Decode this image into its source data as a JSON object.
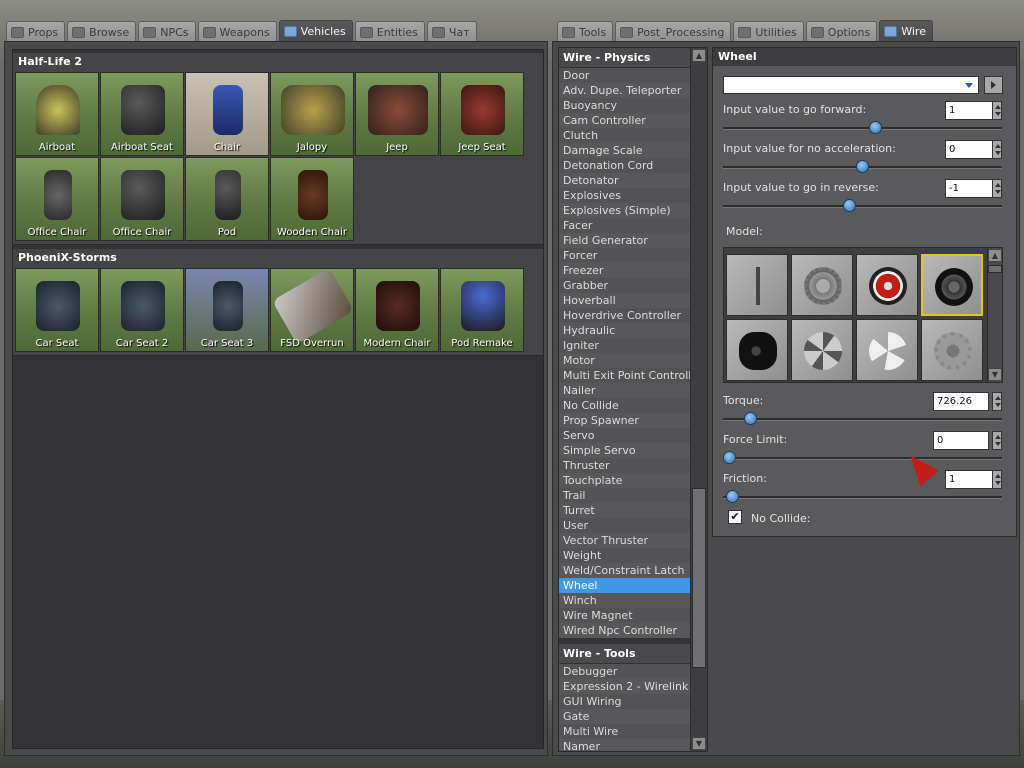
{
  "spawnmenu": {
    "tabs": [
      {
        "label": "Props",
        "icon": "grid-icon"
      },
      {
        "label": "Browse",
        "icon": "browse-icon"
      },
      {
        "label": "NPCs",
        "icon": "npc-icon"
      },
      {
        "label": "Weapons",
        "icon": "weapon-icon"
      },
      {
        "label": "Vehicles",
        "icon": "car-icon",
        "active": true
      },
      {
        "label": "Entities",
        "icon": "entity-icon"
      },
      {
        "label": "Чат",
        "icon": "chat-icon"
      }
    ],
    "categories": [
      {
        "title": "Half-Life 2",
        "items": [
          "Airboat",
          "Airboat Seat",
          "Chair",
          "Jalopy",
          "Jeep",
          "Jeep Seat",
          "Office Chair",
          "Office Chair",
          "Pod",
          "Wooden Chair"
        ]
      },
      {
        "title": "PhoeniX-Storms",
        "items": [
          "Car Seat",
          "Car Seat 2",
          "Car Seat 3",
          "FSD Overrun",
          "Modern Chair",
          "Pod Remake"
        ]
      }
    ]
  },
  "toolmenu": {
    "tabs": [
      {
        "label": "Tools",
        "icon": "wrench-icon"
      },
      {
        "label": "Post_Processing",
        "icon": "doc-icon"
      },
      {
        "label": "Utilities",
        "icon": "wrench-icon"
      },
      {
        "label": "Options",
        "icon": "options-icon"
      },
      {
        "label": "Wire",
        "icon": "wrench-icon",
        "active": true
      }
    ],
    "physics_header": "Wire - Physics",
    "physics_items": [
      "Door",
      "Adv. Dupe. Teleporter",
      "Buoyancy",
      "Cam Controller",
      "Clutch",
      "Damage Scale",
      "Detonation Cord",
      "Detonator",
      "Explosives",
      "Explosives (Simple)",
      "Facer",
      "Field Generator",
      "Forcer",
      "Freezer",
      "Grabber",
      "Hoverball",
      "Hoverdrive Controller",
      "Hydraulic",
      "Igniter",
      "Motor",
      "Multi Exit Point Controller",
      "Nailer",
      "No Collide",
      "Prop Spawner",
      "Servo",
      "Simple Servo",
      "Thruster",
      "Touchplate",
      "Trail",
      "Turret",
      "User",
      "Vector Thruster",
      "Weight",
      "Weld/Constraint Latch",
      "Wheel",
      "Winch",
      "Wire Magnet",
      "Wired Npc Controller"
    ],
    "selected_item": "Wheel",
    "tools_header": "Wire - Tools",
    "tools_items": [
      "Debugger",
      "Expression 2 - Wirelink",
      "GUI Wiring",
      "Gate",
      "Multi Wire",
      "Namer"
    ]
  },
  "wheel_panel": {
    "title": "Wheel",
    "preset_value": "",
    "forward_label": "Input value to go forward:",
    "forward_value": "1",
    "forward_fraction": 0.55,
    "noaccel_label": "Input value for no acceleration:",
    "noaccel_value": "0",
    "noaccel_fraction": 0.5,
    "reverse_label": "Input value to go in reverse:",
    "reverse_value": "-1",
    "reverse_fraction": 0.45,
    "model_label": "Model:",
    "models": [
      "axle-model-icon",
      "gear-model-icon",
      "red-rim-wheel-icon",
      "tire-wheel-icon",
      "thick-tire-icon",
      "fan-wheel-icon",
      "propeller-icon",
      "cog-icon"
    ],
    "selected_model_index": 3,
    "torque_label": "Torque:",
    "torque_value": "726.26",
    "torque_fraction": 0.08,
    "force_label": "Force Limit:",
    "force_value": "0",
    "force_fraction": 0.0,
    "friction_label": "Friction:",
    "friction_value": "1",
    "friction_fraction": 0.01,
    "nocollide_label": "No Collide:",
    "nocollide_checked": true
  }
}
